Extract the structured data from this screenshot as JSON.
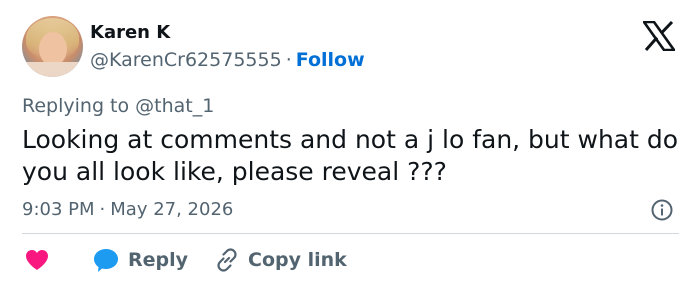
{
  "author": {
    "name": "Karen K",
    "handle": "@KarenCr62575555",
    "separator": "·",
    "follow_label": "Follow"
  },
  "reply_context": {
    "text": "Replying to @that_1"
  },
  "tweet": {
    "text": "Looking at comments and not a j lo fan, but what do you all look like, please reveal ???"
  },
  "meta": {
    "time": "9:03 PM",
    "separator": "·",
    "date": "May 27, 2026"
  },
  "actions": {
    "reply_label": "Reply",
    "copy_link_label": "Copy link"
  },
  "colors": {
    "like_heart": "#f91880",
    "reply_bubble": "#1d9bf0",
    "follow_link": "#006fd6",
    "secondary_text": "#536471",
    "primary_text": "#0f1419",
    "divider": "#cfd9de"
  },
  "icons": {
    "platform_logo": "x-logo-icon",
    "like": "heart-icon",
    "reply": "speech-bubble-icon",
    "copy_link": "link-icon",
    "info": "info-icon"
  }
}
